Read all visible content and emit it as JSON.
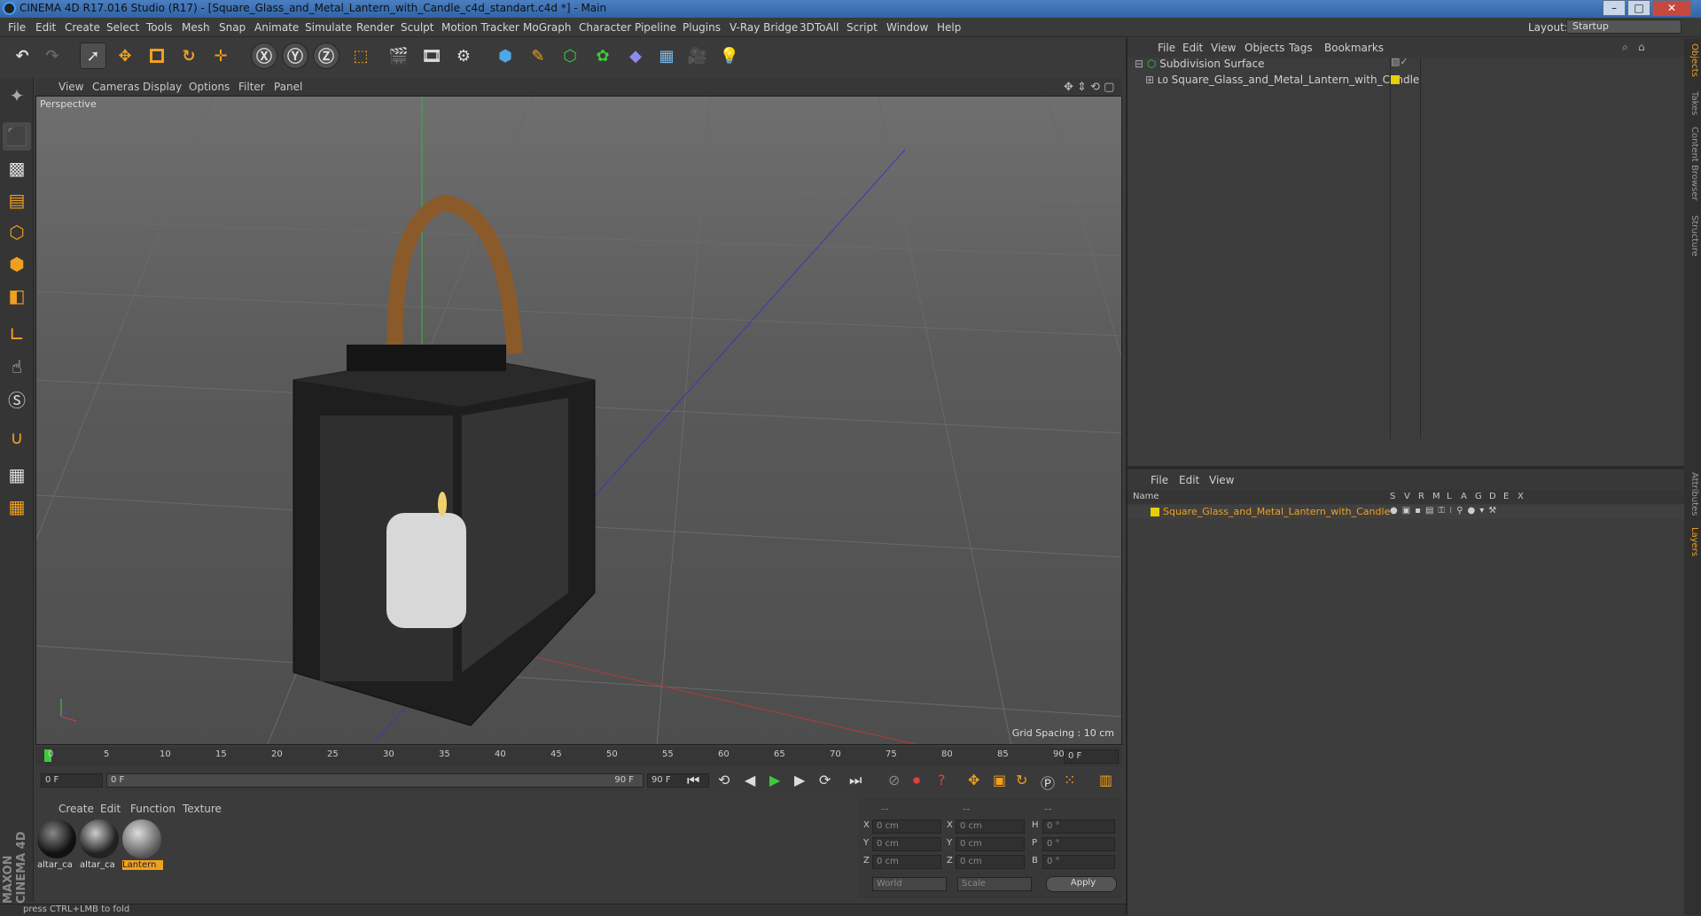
{
  "window": {
    "title": "CINEMA 4D R17.016 Studio (R17) - [Square_Glass_and_Metal_Lantern_with_Candle_c4d_standart.c4d *] - Main"
  },
  "menubar": {
    "items": [
      "File",
      "Edit",
      "Create",
      "Select",
      "Tools",
      "Mesh",
      "Snap",
      "Animate",
      "Simulate",
      "Render",
      "Sculpt",
      "Motion Tracker",
      "MoGraph",
      "Character",
      "Pipeline",
      "Plugins",
      "V-Ray Bridge",
      "3DToAll",
      "Script",
      "Window",
      "Help"
    ],
    "layout_label": "Layout:",
    "layout_value": "Startup"
  },
  "viewport": {
    "menu": [
      "View",
      "Cameras",
      "Display",
      "Options",
      "Filter",
      "Panel"
    ],
    "label": "Perspective",
    "grid_spacing": "Grid Spacing : 10 cm"
  },
  "timeline": {
    "ticks": [
      "0",
      "5",
      "10",
      "15",
      "20",
      "25",
      "30",
      "35",
      "40",
      "45",
      "50",
      "55",
      "60",
      "65",
      "70",
      "75",
      "80",
      "85",
      "90"
    ],
    "frame_field": "0 F"
  },
  "transport": {
    "start": "0 F",
    "range_start": "0 F",
    "range_end": "90 F",
    "end": "90 F"
  },
  "materials": {
    "menu": [
      "Create",
      "Edit",
      "Function",
      "Texture"
    ],
    "items": [
      "altar_ca",
      "altar_ca",
      "Lantern"
    ]
  },
  "coords": {
    "headers": [
      "--",
      "--",
      "--"
    ],
    "rows": [
      {
        "axis": "X",
        "pos": "0 cm",
        "axis2": "X",
        "size": "0 cm",
        "rot_axis": "H",
        "rot": "0 °"
      },
      {
        "axis": "Y",
        "pos": "0 cm",
        "axis2": "Y",
        "size": "0 cm",
        "rot_axis": "P",
        "rot": "0 °"
      },
      {
        "axis": "Z",
        "pos": "0 cm",
        "axis2": "Z",
        "size": "0 cm",
        "rot_axis": "B",
        "rot": "0 °"
      }
    ],
    "mode": "World",
    "scale": "Scale",
    "apply": "Apply"
  },
  "status": {
    "text": "press CTRL+LMB to fold"
  },
  "objects": {
    "menu": [
      "File",
      "Edit",
      "View",
      "Objects",
      "Tags",
      "Bookmarks"
    ],
    "items": [
      {
        "name": "Subdivision Surface"
      },
      {
        "name": "Square_Glass_and_Metal_Lantern_with_Candle"
      }
    ]
  },
  "layers": {
    "menu": [
      "File",
      "Edit",
      "View"
    ],
    "columns": [
      "Name",
      "S",
      "V",
      "R",
      "M",
      "L",
      "A",
      "G",
      "D",
      "E",
      "X"
    ],
    "row": "Square_Glass_and_Metal_Lantern_with_Candle"
  },
  "right_tabs": [
    "Objects",
    "Takes",
    "Content Browser",
    "Structure",
    "Attributes",
    "Layers"
  ],
  "brand": {
    "text": "MAXON CINEMA 4D"
  },
  "colors": {
    "accent": "#f0a020",
    "layer_yellow": "#e8d000",
    "play_green": "#3ec93e"
  }
}
